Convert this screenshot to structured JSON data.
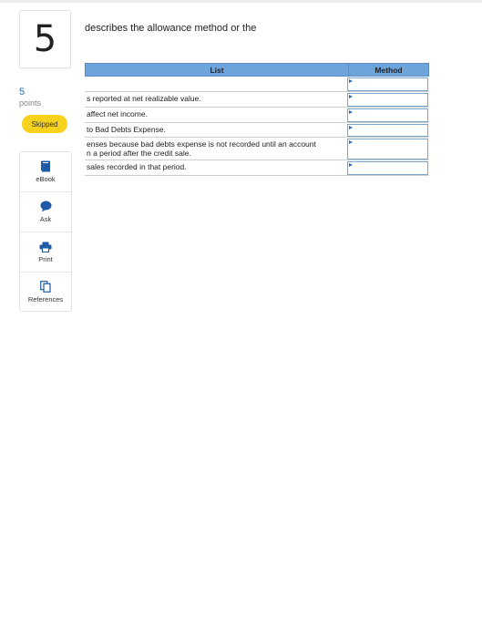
{
  "question": {
    "number": "5",
    "points_value": "5",
    "points_label": "points",
    "status": "Skipped",
    "text": "describes the allowance method or the"
  },
  "tools": [
    {
      "label": "eBook",
      "icon": "book-icon"
    },
    {
      "label": "Ask",
      "icon": "chat-bubble-icon"
    },
    {
      "label": "Print",
      "icon": "printer-icon"
    },
    {
      "label": "References",
      "icon": "copy-documents-icon"
    }
  ],
  "table": {
    "headers": {
      "list": "List",
      "method": "Method"
    },
    "rows": [
      {
        "text": "",
        "method": ""
      },
      {
        "text": "s reported at net realizable value.",
        "method": ""
      },
      {
        "text": "affect net income.",
        "method": ""
      },
      {
        "text": "to Bad Debts Expense.",
        "method": ""
      },
      {
        "text": "enses because bad debts expense is not recorded until an account\nn a period after the credit sale.",
        "method": ""
      },
      {
        "text": "sales recorded in that period.",
        "method": ""
      }
    ]
  },
  "colors": {
    "header_bg": "#6fa3dc",
    "skipped_badge": "#f7d21d",
    "icon_blue": "#1f5aa6",
    "points_blue": "#2a6fb0"
  }
}
